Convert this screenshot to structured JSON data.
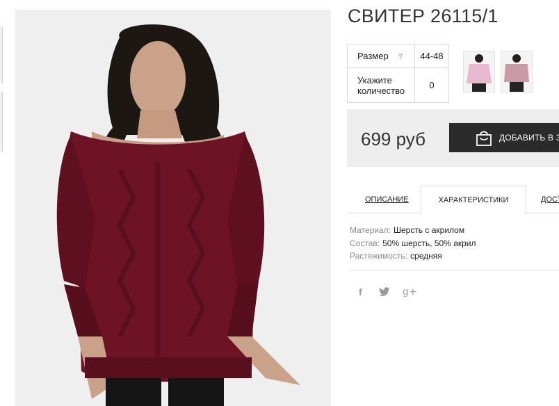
{
  "product": {
    "title": "СВИТЕР 26115/1"
  },
  "options": {
    "size_label": "Размер",
    "size_help": "?",
    "size_value": "44-48",
    "qty_label": "Укажите количество",
    "qty_value": "0"
  },
  "purchase": {
    "price": "699 руб",
    "add_to_cart_label": "ДОБАВИТЬ В ЗА"
  },
  "tabs": [
    {
      "label": "ОПИСАНИЕ"
    },
    {
      "label": "ХАРАКТЕРИСТИКИ"
    },
    {
      "label": "ДОСТ"
    }
  ],
  "specs": [
    {
      "key": "Материал:",
      "value": "Шерсть с акрилом"
    },
    {
      "key": "Состав:",
      "value": "50% шерсть, 50% акрил"
    },
    {
      "key": "Растяжимость:",
      "value": "средняя"
    }
  ],
  "social": {
    "facebook": "f",
    "twitter": "🐦",
    "gplus": "g+"
  },
  "colors": {
    "sweater": "#6e1326",
    "button_bg": "#2b2b2b",
    "price_bar_bg": "#eeeeee",
    "swatch_pink": "#e7b8cf",
    "swatch_mauve": "#c99aa7"
  },
  "icons": {
    "add_to_cart": "shopping-bag-icon",
    "facebook": "facebook-icon",
    "twitter": "twitter-icon",
    "gplus": "google-plus-icon"
  }
}
